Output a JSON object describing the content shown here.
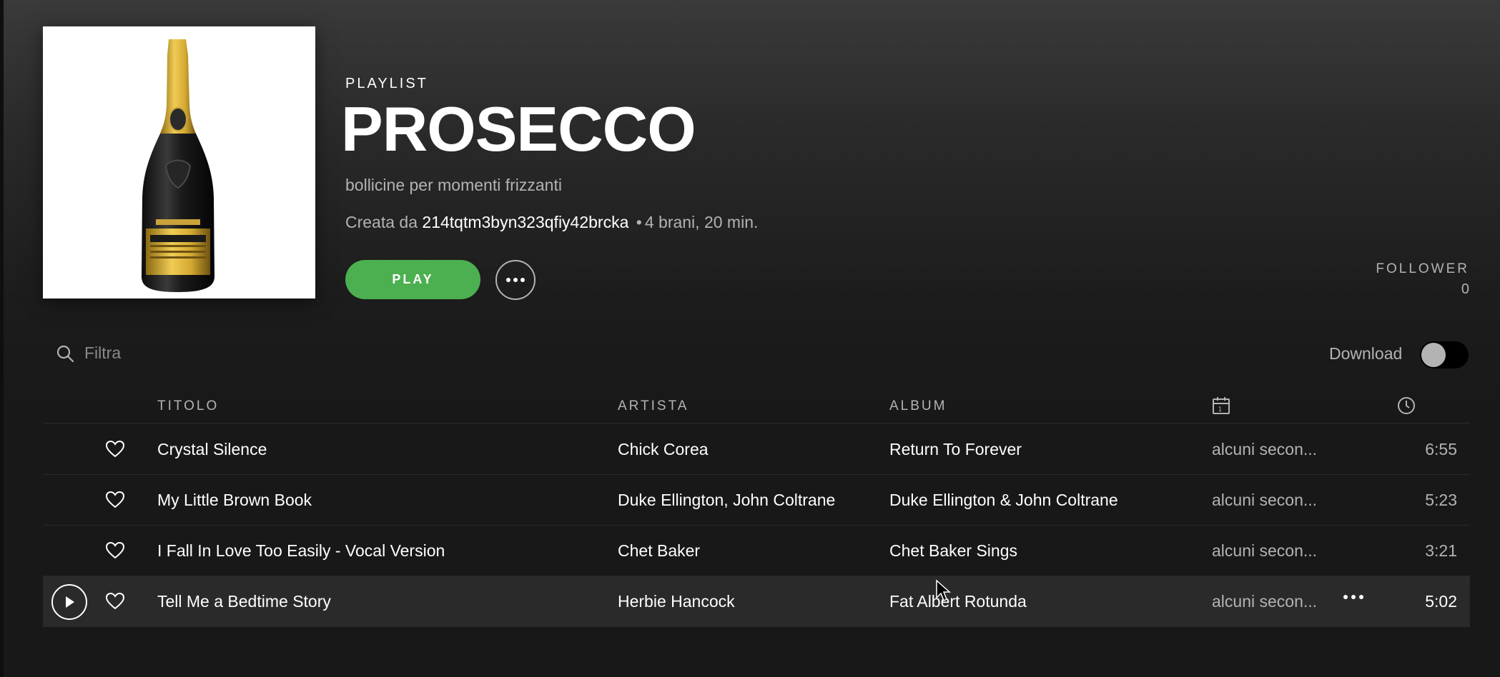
{
  "playlist": {
    "type_label": "PLAYLIST",
    "title": "PROSECCO",
    "description": "bollicine per momenti frizzanti",
    "created_by_prefix": "Creata da",
    "owner": "214tqtm3byn323qfiy42brcka",
    "separator": "•",
    "stats": "4 brani, 20 min.",
    "cover_icon": "prosecco-bottle-image"
  },
  "actions": {
    "play_label": "PLAY",
    "more_icon": "more-dots-icon"
  },
  "followers": {
    "label": "FOLLOWER",
    "count": "0"
  },
  "filter": {
    "placeholder": "Filtra",
    "value": "",
    "icon": "search-icon"
  },
  "download": {
    "label": "Download",
    "enabled": false
  },
  "table": {
    "columns": {
      "title": "TITOLO",
      "artist": "ARTISTA",
      "album": "ALBUM",
      "date_icon": "calendar-icon",
      "duration_icon": "clock-icon"
    },
    "rows": [
      {
        "title": "Crystal Silence",
        "artist": "Chick Corea",
        "album": "Return To Forever",
        "added": "alcuni secon...",
        "duration": "6:55"
      },
      {
        "title": "My Little Brown Book",
        "artist": "Duke Ellington, John Coltrane",
        "album": "Duke Ellington & John Coltrane",
        "added": "alcuni secon...",
        "duration": "5:23"
      },
      {
        "title": "I Fall In Love Too Easily - Vocal Version",
        "artist": "Chet Baker",
        "album": "Chet Baker Sings",
        "added": "alcuni secon...",
        "duration": "3:21"
      },
      {
        "title": "Tell Me a Bedtime Story",
        "artist": "Herbie Hancock",
        "album": "Fat Albert Rotunda",
        "added": "alcuni secon...",
        "duration": "5:02"
      }
    ]
  },
  "colors": {
    "accent_green": "#4caf50",
    "background": "#181818",
    "text_secondary": "#b3b3b3"
  }
}
